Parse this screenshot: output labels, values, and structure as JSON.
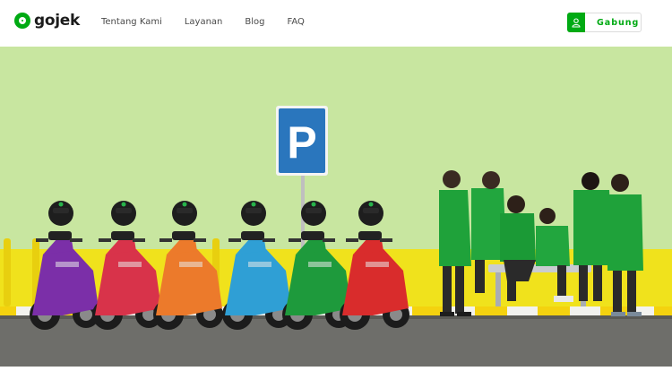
{
  "header": {
    "logo_text": "gojek",
    "nav": [
      "Tentang Kami",
      "Layanan",
      "Blog",
      "FAQ"
    ],
    "join_label": "Gabung"
  },
  "hero": {
    "sign_text": "P",
    "scooter_colors": [
      "#7b2fa8",
      "#d8334a",
      "#ec7a2b",
      "#2f9fd5",
      "#1e9a3c",
      "#d92c2c"
    ]
  },
  "colors": {
    "brand_green": "#00aa13",
    "wall": "#c8e6a0",
    "wall_base": "#f0e21c"
  }
}
